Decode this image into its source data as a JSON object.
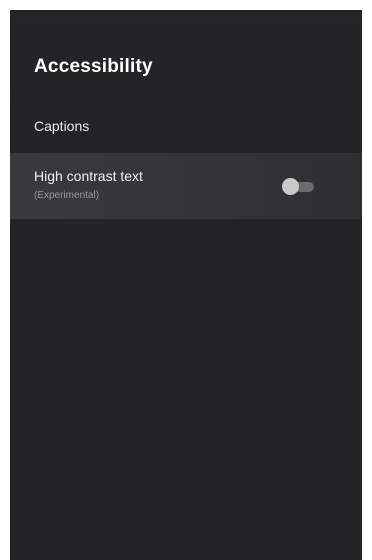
{
  "screen": {
    "title": "Accessibility"
  },
  "settings": {
    "captions": {
      "label": "Captions"
    },
    "high_contrast_text": {
      "label": "High contrast text",
      "sublabel": "(Experimental)",
      "toggle_state": "off"
    }
  },
  "colors": {
    "background": "#242426",
    "highlight_row": "#3a3a3c",
    "text_primary": "#ffffff",
    "text_secondary": "#9a9a9c",
    "toggle_thumb": "#c9c9c9",
    "toggle_track": "#6c6c6e"
  }
}
